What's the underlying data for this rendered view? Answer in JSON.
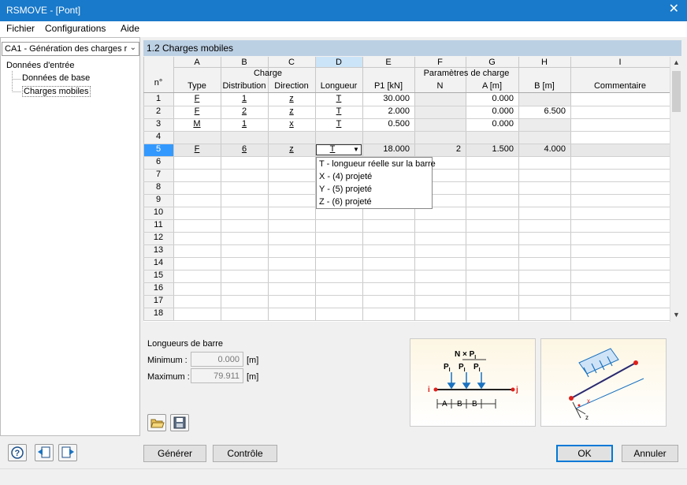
{
  "window": {
    "title": "RSMOVE - [Pont]",
    "close_glyph": "✕"
  },
  "menu": [
    "Fichier",
    "Configurations",
    "Aide"
  ],
  "case_select": {
    "value": "CA1 - Génération des charges r"
  },
  "tree": {
    "root": "Données d'entrée",
    "items": [
      "Données de base",
      "Charges mobiles"
    ]
  },
  "main_title": "1.2 Charges mobiles",
  "grid": {
    "col_letters": [
      "A",
      "B",
      "C",
      "D",
      "E",
      "F",
      "G",
      "H",
      "I"
    ],
    "row_no_header": "n°",
    "group_headers": {
      "charge": "Charge",
      "params": "Paramètres de charge"
    },
    "col_headers": [
      "Type",
      "Distribution",
      "Direction",
      "Longueur",
      "P1 [kN]",
      "N",
      "A [m]",
      "B [m]",
      "Commentaire"
    ],
    "rows": [
      {
        "n": "1",
        "cells": [
          "F",
          "1",
          "z",
          "T",
          "30.000",
          "",
          "0.000",
          "",
          ""
        ]
      },
      {
        "n": "2",
        "cells": [
          "F",
          "2",
          "z",
          "T",
          "2.000",
          "",
          "0.000",
          "6.500",
          ""
        ]
      },
      {
        "n": "3",
        "cells": [
          "M",
          "1",
          "x",
          "T",
          "0.500",
          "",
          "0.000",
          "",
          ""
        ]
      },
      {
        "n": "4",
        "cells": [
          "",
          "",
          "",
          "",
          "",
          "",
          "",
          "",
          ""
        ]
      },
      {
        "n": "5",
        "cells": [
          "F",
          "6",
          "z",
          "T",
          "18.000",
          "2",
          "1.500",
          "4.000",
          ""
        ]
      },
      {
        "n": "6",
        "cells": [
          "",
          "",
          "",
          "",
          "",
          "",
          "",
          "",
          ""
        ]
      },
      {
        "n": "7",
        "cells": [
          "",
          "",
          "",
          "",
          "",
          "",
          "",
          "",
          ""
        ]
      },
      {
        "n": "8",
        "cells": [
          "",
          "",
          "",
          "",
          "",
          "",
          "",
          "",
          ""
        ]
      },
      {
        "n": "9",
        "cells": [
          "",
          "",
          "",
          "",
          "",
          "",
          "",
          "",
          ""
        ]
      },
      {
        "n": "10",
        "cells": [
          "",
          "",
          "",
          "",
          "",
          "",
          "",
          "",
          ""
        ]
      },
      {
        "n": "11",
        "cells": [
          "",
          "",
          "",
          "",
          "",
          "",
          "",
          "",
          ""
        ]
      },
      {
        "n": "12",
        "cells": [
          "",
          "",
          "",
          "",
          "",
          "",
          "",
          "",
          ""
        ]
      },
      {
        "n": "13",
        "cells": [
          "",
          "",
          "",
          "",
          "",
          "",
          "",
          "",
          ""
        ]
      },
      {
        "n": "14",
        "cells": [
          "",
          "",
          "",
          "",
          "",
          "",
          "",
          "",
          ""
        ]
      },
      {
        "n": "15",
        "cells": [
          "",
          "",
          "",
          "",
          "",
          "",
          "",
          "",
          ""
        ]
      },
      {
        "n": "16",
        "cells": [
          "",
          "",
          "",
          "",
          "",
          "",
          "",
          "",
          ""
        ]
      },
      {
        "n": "17",
        "cells": [
          "",
          "",
          "",
          "",
          "",
          "",
          "",
          "",
          ""
        ]
      },
      {
        "n": "18",
        "cells": [
          "",
          "",
          "",
          "",
          "",
          "",
          "",
          "",
          ""
        ]
      }
    ],
    "selected_row": "5"
  },
  "dropdown_options": [
    "T - longueur réelle sur la barre",
    "X - (4) projeté",
    "Y - (5) projeté",
    "Z - (6) projeté"
  ],
  "bar_lengths": {
    "title": "Longueurs de barre",
    "min_label": "Minimum :",
    "min_value": "0.000",
    "min_unit": "[m]",
    "max_label": "Maximum :",
    "max_value": "79.911",
    "max_unit": "[m]"
  },
  "diagram1": {
    "n_label": "N × P",
    "n_sub": "I",
    "p_label": "P",
    "p_sub": "I",
    "node_i": "i",
    "node_j": "j",
    "dims": [
      "A",
      "B",
      "B"
    ]
  },
  "diagram2": {
    "x_label": "x",
    "z_label": "z"
  },
  "buttons": {
    "generate": "Générer",
    "check": "Contrôle",
    "ok": "OK",
    "cancel": "Annuler"
  },
  "icons": [
    "help-icon",
    "import-icon",
    "export-icon",
    "open-folder-icon",
    "save-icon"
  ],
  "colors": {
    "title_bar": "#1979ca",
    "header_band": "#bcd0e4",
    "selected_row": "#3399ff",
    "arrow_blue": "#1a72c0",
    "beam_red": "#e0201c"
  }
}
